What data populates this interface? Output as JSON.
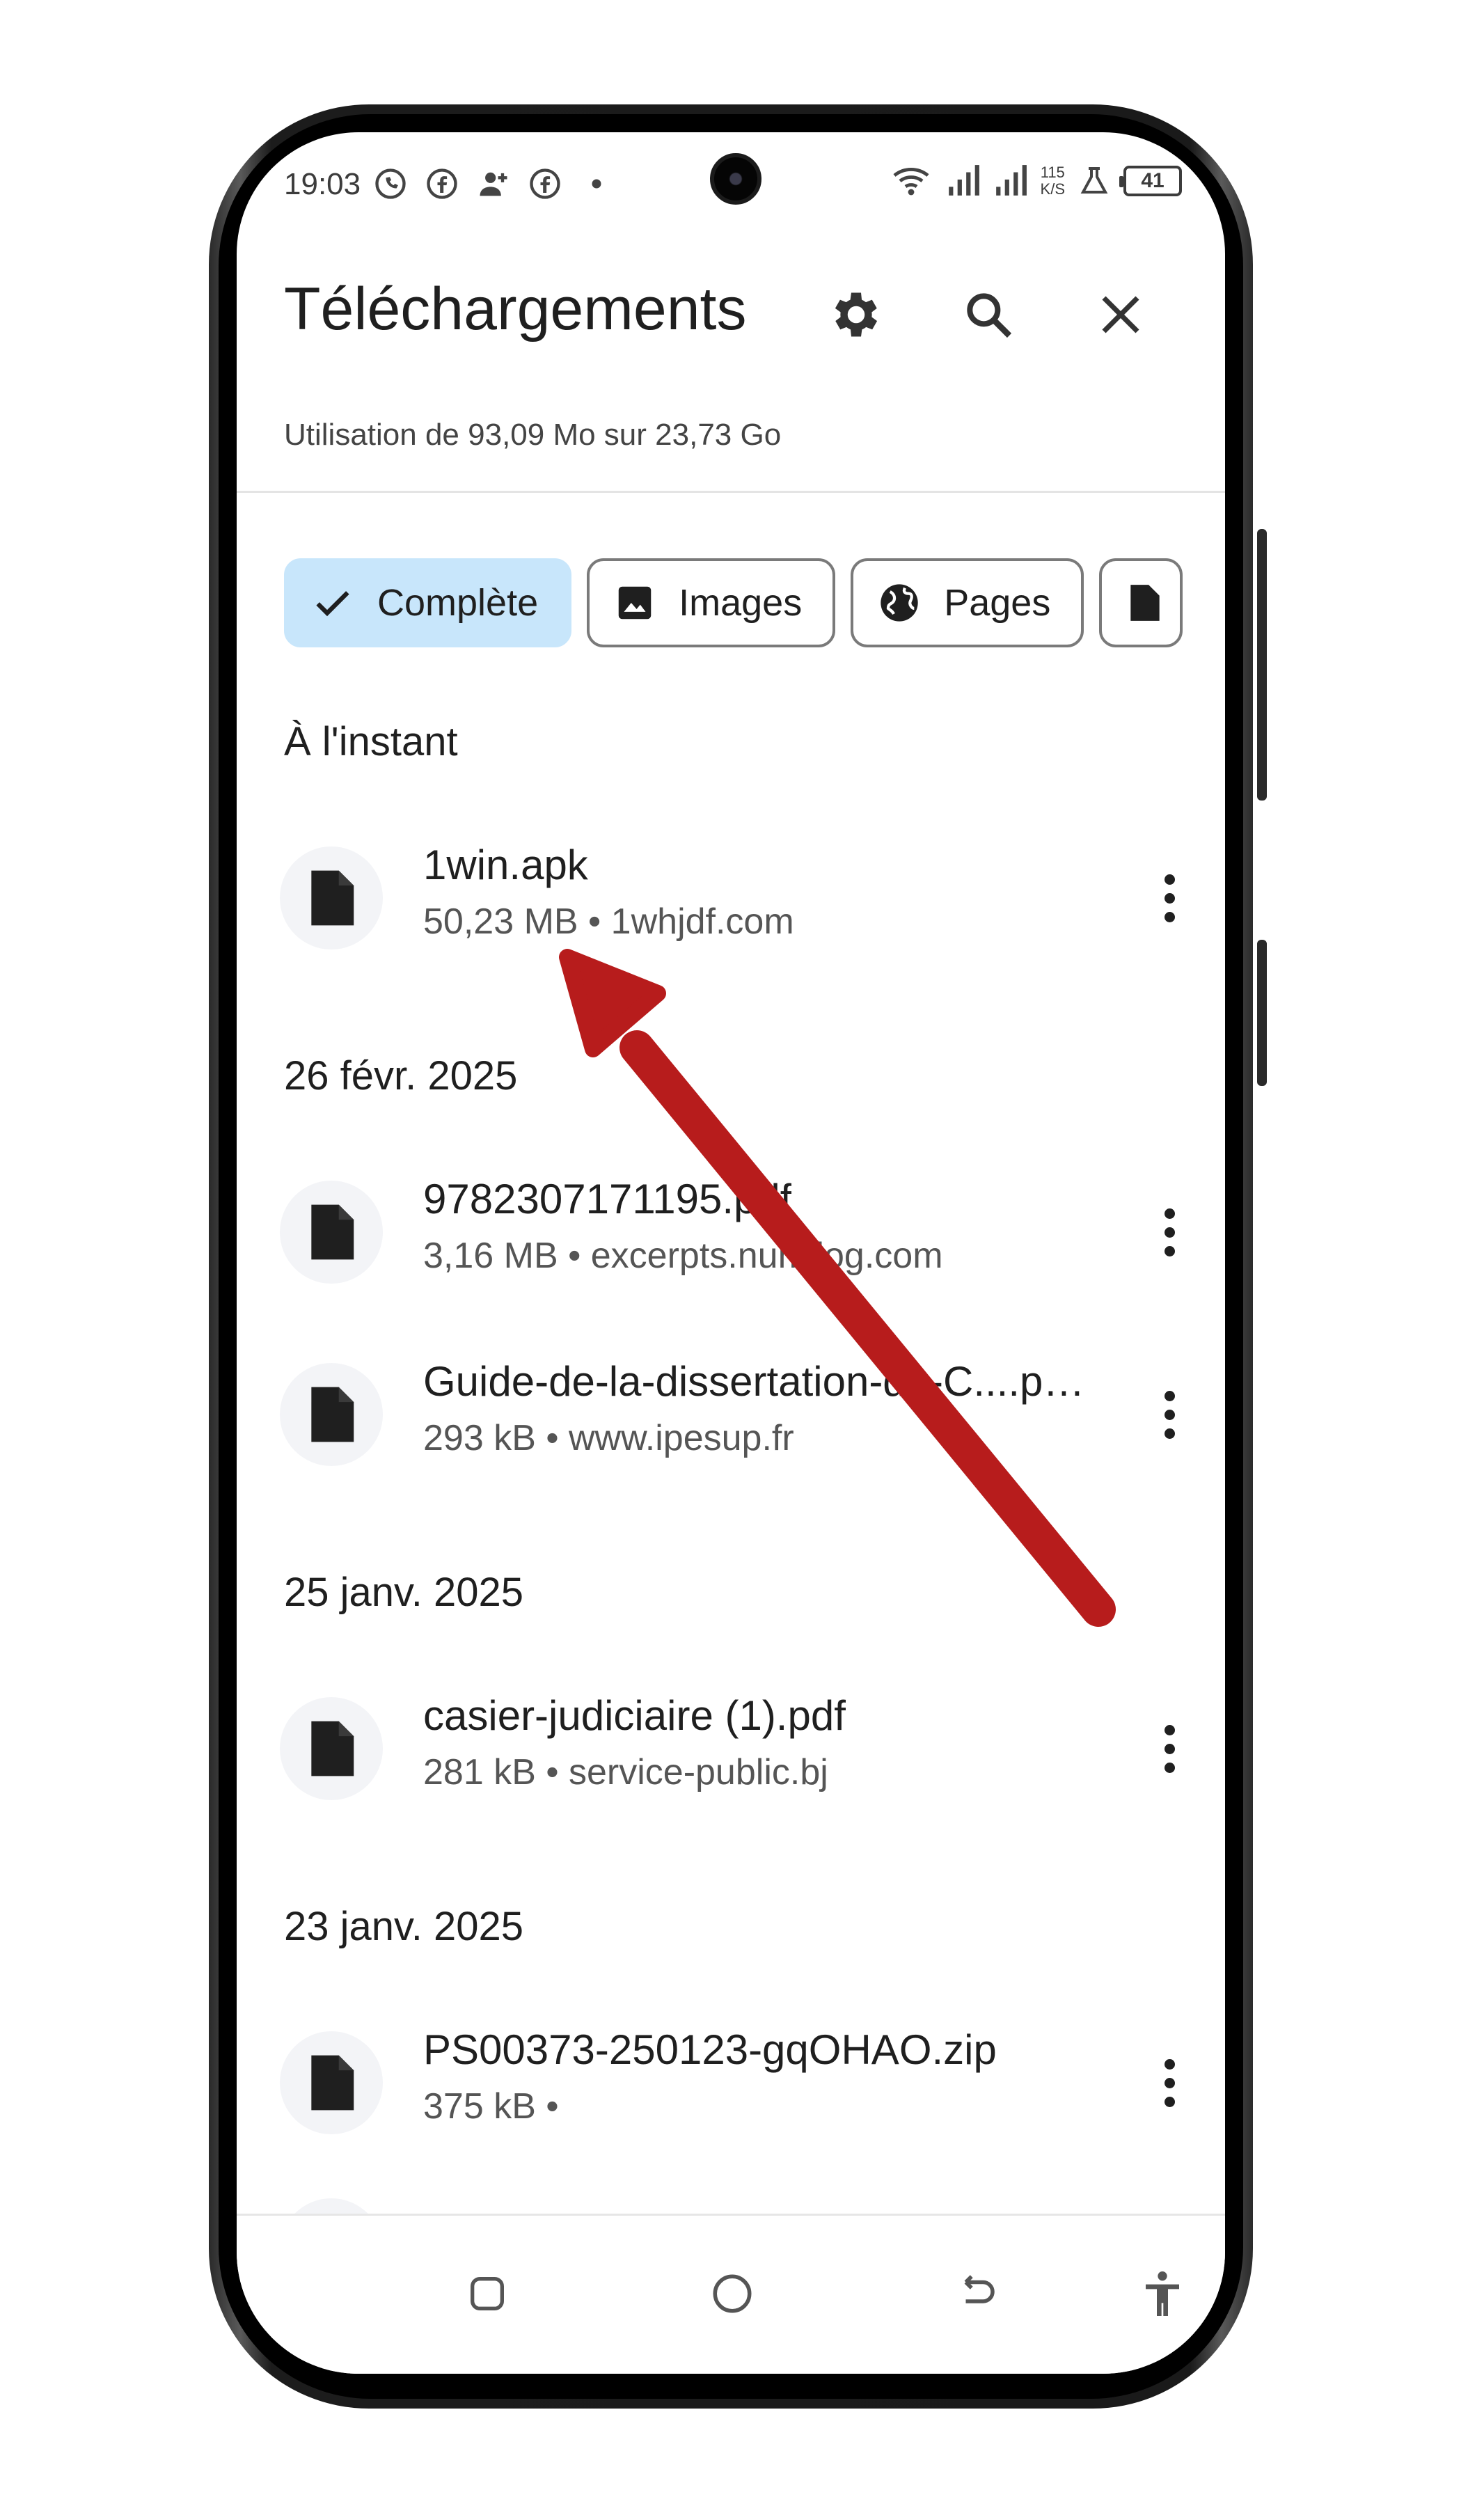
{
  "status_bar": {
    "time": "19:03",
    "network_speed_value": "115",
    "network_speed_unit": "K/S",
    "battery": "41"
  },
  "header": {
    "title": "Téléchargements",
    "settings_icon": "gear-icon",
    "search_icon": "search-icon",
    "close_icon": "close-icon"
  },
  "storage": {
    "usage_text": "Utilisation de 93,09 Mo sur 23,73 Go"
  },
  "filters": [
    {
      "label": "Complète",
      "icon": "check-icon",
      "active": true
    },
    {
      "label": "Images",
      "icon": "image-icon",
      "active": false
    },
    {
      "label": "Pages",
      "icon": "globe-icon",
      "active": false
    }
  ],
  "sections": [
    {
      "heading": "À l'instant",
      "items": [
        {
          "name": "1win.apk",
          "meta": "50,23 MB • 1whjdf.com"
        }
      ]
    },
    {
      "heading": "26 févr. 2025",
      "items": [
        {
          "name": "9782307171195.pdf",
          "meta": "3,16 MB • excerpts.numilog.com"
        },
        {
          "name": "Guide-de-la-dissertation-de-C....p…",
          "meta": "293 kB • www.ipesup.fr"
        }
      ]
    },
    {
      "heading": "25 janv. 2025",
      "items": [
        {
          "name": "casier-judiciaire (1).pdf",
          "meta": "281 kB • service-public.bj"
        }
      ]
    },
    {
      "heading": "23 janv. 2025",
      "items": [
        {
          "name": "PS00373-250123-gqOHAO.zip",
          "meta": "375 kB •"
        }
      ]
    }
  ],
  "annotation": {
    "color": "#b71c1c"
  },
  "colors": {
    "active_chip_bg": "#c8e6fb",
    "text_primary": "#1f1f1f",
    "text_secondary": "#555555"
  }
}
